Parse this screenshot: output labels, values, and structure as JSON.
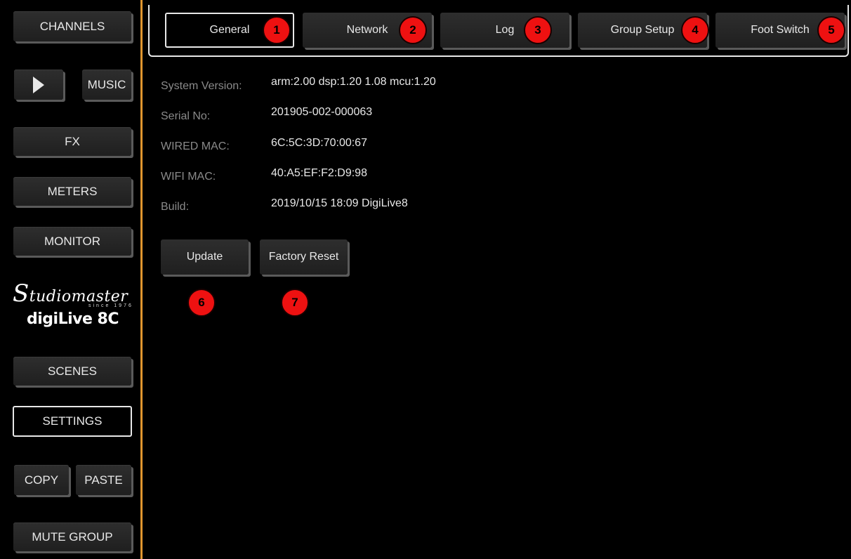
{
  "sidebar": {
    "channels": "CHANNELS",
    "play": "play-icon",
    "music": "MUSIC",
    "fx": "FX",
    "meters": "METERS",
    "monitor": "MONITOR",
    "scenes": "SCENES",
    "settings": "SETTINGS",
    "copy": "COPY",
    "paste": "PASTE",
    "mute_group": "MUTE GROUP"
  },
  "logo": {
    "brand_initial": "S",
    "brand_rest": "tudiomaster",
    "since": "since 1976",
    "model": "digiLive 8C"
  },
  "tabs": [
    {
      "label": "General",
      "badge": "1"
    },
    {
      "label": "Network",
      "badge": "2"
    },
    {
      "label": "Log",
      "badge": "3"
    },
    {
      "label": "Group Setup",
      "badge": "4"
    },
    {
      "label": "Foot Switch",
      "badge": "5"
    }
  ],
  "info": [
    {
      "label": "System Version:",
      "value": "arm:2.00 dsp:1.20 1.08 mcu:1.20"
    },
    {
      "label": "Serial No:",
      "value": "201905-002-000063"
    },
    {
      "label": "WIRED MAC:",
      "value": "6C:5C:3D:70:00:67"
    },
    {
      "label": "WIFI MAC:",
      "value": "40:A5:EF:F2:D9:98"
    },
    {
      "label": "Build:",
      "value": "2019/10/15 18:09 DigiLive8"
    }
  ],
  "actions": {
    "update": {
      "label": "Update",
      "badge": "6"
    },
    "factory_reset": {
      "label": "Factory Reset",
      "badge": "7"
    }
  },
  "colors": {
    "accent_divider": "#e0962f",
    "badge": "#ee1111"
  }
}
